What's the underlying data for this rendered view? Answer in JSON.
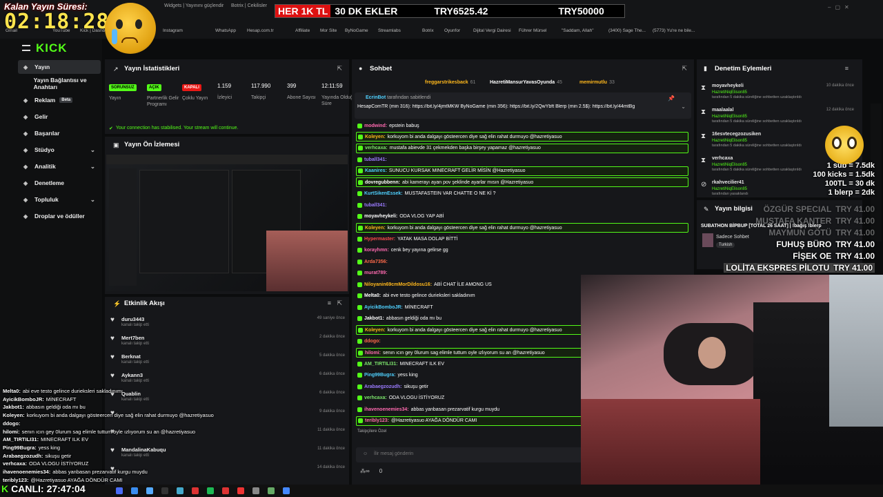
{
  "overlay": {
    "timer_label": "Kalan Yayın Süresi:",
    "timer": "02:18:28",
    "live_label": "CANLI:",
    "live_time": "27:47:04",
    "ticker": [
      {
        "text": "HER 1K TL"
      },
      {
        "text": "30 DK EKLER"
      },
      {
        "text": "TRY6525.42"
      },
      {
        "text": "TRY50000"
      }
    ],
    "rates": [
      "1 sub = 7.5dk",
      "100 kicks = 1.5dk",
      "100TL = 30 dk",
      "1 blerp = 2dk"
    ],
    "donations": [
      {
        "name": "ÖZGÜR SPECIAL",
        "amt": "TRY 41.00"
      },
      {
        "name": "MUSTAFA KANTER",
        "amt": "TRY 41.00"
      },
      {
        "name": "MAYMUN GÖTÜ",
        "amt": "TRY 41.00"
      },
      {
        "name": "FUHUŞ BÜRO",
        "amt": "TRY 41.00"
      },
      {
        "name": "FİŞEK OE",
        "amt": "TRY 41.00"
      },
      {
        "name": "LOLİTA EKSPRES PİLOTU",
        "amt": "TRY 41.00"
      }
    ],
    "chat": [
      {
        "u": "Melta0:",
        "t": "abi eve testo gelince durieksleri sakladınımı",
        "c": "#ffffff"
      },
      {
        "u": "AyicikBomboJR:",
        "t": "MİNECRAFT",
        "c": "#ffffff"
      },
      {
        "u": "Jakbot1:",
        "t": "abbasın geldiği oda mı bu",
        "c": "#ffffff"
      },
      {
        "u": "Koleyen:",
        "t": "korkuyom bi anda dalgayı gösteercen diye sağ elin rahat durmuyo @hazretiyasuo",
        "c": "#ffffff"
      },
      {
        "u": "ddogo:",
        "t": "",
        "c": "#ffffff"
      },
      {
        "u": "hilomi:",
        "t": "senın ıcın gey 0lurum sag elimle tuttum oyle ızlıyorum su an @hazretiyasuo",
        "c": "#ffffff"
      },
      {
        "u": "AM_TIRTILI31:",
        "t": "MINECRAFT ILK EV",
        "c": "#ffffff"
      },
      {
        "u": "Ping99Bugra:",
        "t": "yess king",
        "c": "#ffffff"
      },
      {
        "u": "Arabaegzozudh:",
        "t": "sikuşu getir",
        "c": "#ffffff"
      },
      {
        "u": "verhcaxa:",
        "t": "ODA VLOGU İSTİYORUZ",
        "c": "#ffffff"
      },
      {
        "u": "ihavenoenemies34:",
        "t": "abbas yanbasan prezarvatif kurgu muydu",
        "c": "#ffffff"
      },
      {
        "u": "teribly123:",
        "t": "@Hazretiyasuo AYAĞA DÖNDÜR CAMI",
        "c": "#ffffff"
      }
    ]
  },
  "browser": {
    "tabs": [
      "Widgets | Yayınını güçlendir",
      "Botrix | Cekilisler"
    ],
    "bookmarks": [
      "Gmail",
      "YouTube",
      "Kick | Dashboard",
      "Instagram",
      "WhatsApp",
      "Hesap.com.tr",
      "Affiliate",
      "Mor Site",
      "ByNoGame",
      "Streamlabs",
      "Botrix",
      "Oyunfor",
      "Dijital Vergi Dairesi",
      "Führer Mürsel",
      "\"Saddam, Allah\"",
      "(3400) Sage The...",
      "(5773) Yu're ne bile..."
    ]
  },
  "kick": {
    "logo": "KICK",
    "nav": [
      {
        "label": "Yayın",
        "active": true
      },
      {
        "label": "Yayın Bağlantısı ve Anahtarı"
      },
      {
        "label": "Reklam",
        "badge": "Beta"
      },
      {
        "label": "Gelir"
      },
      {
        "label": "Başarılar"
      },
      {
        "label": "Stüdyo"
      },
      {
        "label": "Analitik"
      },
      {
        "label": "Denetleme"
      },
      {
        "label": "Topluluk"
      },
      {
        "label": "Droplar ve ödüller"
      }
    ],
    "stats": {
      "title": "Yayın İstatistikleri",
      "items": [
        {
          "badge": "SORUNSUZ",
          "label": "Yayın"
        },
        {
          "badge": "AÇIK",
          "label": "Partnerlik Gelir Programı"
        },
        {
          "badge": "KAPALI",
          "label": "Çoklu Yayın"
        },
        {
          "value": "1.159",
          "label": "İzleyici"
        },
        {
          "value": "117.990",
          "label": "Takipçi"
        },
        {
          "value": "399",
          "label": "Abone Sayısı"
        },
        {
          "value": "12:11:59",
          "label": "Yayında Olduğu Süre"
        }
      ],
      "notice": "Your connection has stabilised. Your stream will continue."
    },
    "preview": {
      "title": "Yayın Ön İzlemesi"
    },
    "activity": {
      "title": "Etkinlik Akışı",
      "rows": [
        {
          "name": "duru3443",
          "sub": "kanalı takip etti",
          "time": "49 saniye önce"
        },
        {
          "name": "Mert7ben",
          "sub": "kanalı takip etti",
          "time": "2 dakika önce"
        },
        {
          "name": "Berknat",
          "sub": "kanalı takip etti",
          "time": "5 dakika önce"
        },
        {
          "name": "Aykann3",
          "sub": "kanalı takip etti",
          "time": "6 dakika önce"
        },
        {
          "name": "Quablin",
          "sub": "kanalı takip etti",
          "time": "6 dakika önce"
        },
        {
          "name": "",
          "sub": "",
          "time": "9 dakika önce"
        },
        {
          "name": "",
          "sub": "",
          "time": "11 dakika önce"
        },
        {
          "name": "MandalinaKabuqu",
          "sub": "kanalı takip etti",
          "time": "11 dakika önce"
        },
        {
          "name": "",
          "sub": "",
          "time": "14 dakika önce"
        }
      ]
    },
    "chat": {
      "title": "Sohbet",
      "top_users": [
        {
          "name": "freggarstrikesback",
          "n": "61"
        },
        {
          "name": "HazretiMansurYavasOyunda",
          "n": "45"
        },
        {
          "name": "memirmutlu",
          "n": "33"
        }
      ],
      "pinned_by": "tarafından sabitlendi",
      "pinned_user": "EcrinBot",
      "pinned_text": "HesapComTR (min 316): https://bit.ly/4jmtMKW ByNoGame (min 356): https://bit.ly/2QwYbft Blerp (min 2.5$): https://bit.ly/44mtBg",
      "messages": [
        {
          "u": "modwind:",
          "t": "epstein babuş",
          "c": "#ff6ab0",
          "hl": false
        },
        {
          "u": "Koleyen:",
          "t": "korkuyom bi anda dalgayı gösteercen diye sağ elin rahat durmuyo @hazretiyasuo",
          "c": "#ffb81c",
          "hl": true
        },
        {
          "u": "verhcaxa:",
          "t": "mustafa abievde 31 çekmekden başka birşey yapamaz @hazretiyasuo",
          "c": "#7be36b",
          "hl": true
        },
        {
          "u": "tuball341:",
          "t": "",
          "c": "#9b7bff",
          "hl": false
        },
        {
          "u": "Kaanires:",
          "t": "SUNUCU KURSAK MINECRAFT GELİR MİSİN @Hazretiyasuo",
          "c": "#4fd1ff",
          "hl": true
        },
        {
          "u": "dovregubbenn:",
          "t": "abi kamerayı ayan pov şeklinde ayarlar mısın @Hazretiyasuo",
          "c": "#ffffff",
          "hl": true
        },
        {
          "u": "KurtSikenEssek:",
          "t": "MUSTAFASTEIN VAR CHATTE O NE Kİ ?",
          "c": "#4fd1ff",
          "hl": false
        },
        {
          "u": "tuball341:",
          "t": "",
          "c": "#9b7bff",
          "hl": false
        },
        {
          "u": "moyavheykeli:",
          "t": "ODA VLOG YAP ABİ",
          "c": "#ffffff",
          "hl": false
        },
        {
          "u": "Koleyen:",
          "t": "korkuyom bi anda dalgayı gösteercen diye sağ elin rahat durmuyo @hazretiyasuo",
          "c": "#ffb81c",
          "hl": true
        },
        {
          "u": "Hypermaster:",
          "t": "YATAK MASA DOLAP BİTTİ",
          "c": "#ff4a4a",
          "hl": false
        },
        {
          "u": "korayhmn:",
          "t": "cenk bey yayına gelirse gg",
          "c": "#ff6ab0",
          "hl": false
        },
        {
          "u": "Arda7356:",
          "t": "",
          "c": "#ff6a4a",
          "hl": false
        },
        {
          "u": "murat789:",
          "t": "",
          "c": "#ff6ab0",
          "hl": false
        },
        {
          "u": "Niloyanin69cmMorDildosu16:",
          "t": "ABİ CHAT İLE AMONG US",
          "c": "#ffb81c",
          "hl": false
        },
        {
          "u": "Melta0:",
          "t": "abi eve testo gelince durieksleri sakladınım",
          "c": "#ffffff",
          "hl": false
        },
        {
          "u": "AyicikBomboJR:",
          "t": "MİNECRAFT",
          "c": "#4fd1ff",
          "hl": false
        },
        {
          "u": "Jakbot1:",
          "t": "abbasın geldiği oda mı bu",
          "c": "#ffffff",
          "hl": false
        },
        {
          "u": "Koleyen:",
          "t": "korkuyom bi anda dalgayı gösteercen diye sağ elin rahat durmuyo @hazretiyasuo",
          "c": "#ffb81c",
          "hl": true
        },
        {
          "u": "ddogo:",
          "t": "",
          "c": "#ff6a4a",
          "hl": false
        },
        {
          "u": "hilomi:",
          "t": "senın ıcın gey 0lurum sag elimle tuttum oyle ızlıyorum su an @hazretiyasuo",
          "c": "#ff6ab0",
          "hl": true
        },
        {
          "u": "AM_TIRTILI31:",
          "t": "MINECRAFT ILK EV",
          "c": "#7be36b",
          "hl": false
        },
        {
          "u": "Ping99Bugra:",
          "t": "yess king",
          "c": "#4fd1ff",
          "hl": false
        },
        {
          "u": "Arabaegzozudh:",
          "t": "sikuşu getir",
          "c": "#9b7bff",
          "hl": false
        },
        {
          "u": "verhcaxa:",
          "t": "ODA VLOGU İSTİYORUZ",
          "c": "#7be36b",
          "hl": false
        },
        {
          "u": "ihavenoenemies34:",
          "t": "abbas yanbasan prezarvatif kurgu muydu",
          "c": "#ff6ab0",
          "hl": false
        },
        {
          "u": "teribly123:",
          "t": "@Hazretiyasuo AYAĞA DÖNDÜR CAMI",
          "c": "#ff6ab0",
          "hl": true
        }
      ],
      "gift_label": "Takipçilere Özel",
      "placeholder": "İlir mesaj gönderin",
      "kicks": "0"
    },
    "mod": {
      "title": "Denetim Eylemleri",
      "rows": [
        {
          "name": "moyavheykeli",
          "by": "HazretiNiqElison85",
          "act": "tarafından 5 dakika süreliğine sohbetten uzaklaştırıldı",
          "time": "10 dakika önce"
        },
        {
          "name": "maalaalal",
          "by": "HazretiNiqElison85",
          "act": "tarafından 5 dakika süreliğine sohbetten uzaklaştırıldı",
          "time": "12 dakika önce"
        },
        {
          "name": "16esvtecegzozusiken",
          "by": "HazretiNiqElison85",
          "act": "tarafından 5 dakika süreliğine sohbetten uzaklaştırıldı",
          "time": ""
        },
        {
          "name": "verhcaxa",
          "by": "HazretiNiqElison85",
          "act": "tarafından 5 dakika süreliğine sohbetten uzaklaştırıldı",
          "time": ""
        },
        {
          "name": "rkahvecilier41",
          "by": "HazretiNiqElison85",
          "act": "tarafından yasaklandı",
          "time": ""
        }
      ]
    },
    "info": {
      "title": "Yayın bilgisi",
      "stream_title": "SUBATHON BİPBUP [TOTAL 26 SAAT] | !bağış !blerp",
      "subtitle": "Sadece Sohbet",
      "tag": "Turkish"
    }
  },
  "colors": {
    "kick_green": "#53fc18",
    "badge_green": "#53fc18",
    "badge_red": "#e91916"
  }
}
